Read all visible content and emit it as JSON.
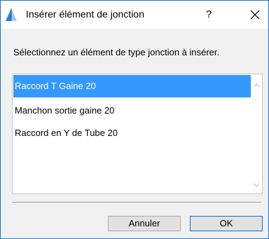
{
  "window": {
    "title": "Insérer élément de jonction",
    "help_label": "?",
    "close_icon": "close-icon",
    "app_icon": "archicad-icon",
    "accent_color": "#1874d4"
  },
  "prompt": "Sélectionnez un élément de type jonction à insérer.",
  "list": {
    "items": [
      {
        "label": "Raccord T Gaine 20",
        "selected": true
      },
      {
        "label": "Manchon sortie gaine 20",
        "selected": false
      },
      {
        "label": "Raccord en Y de Tube 20",
        "selected": false
      }
    ],
    "selection_color": "#3399ff"
  },
  "buttons": {
    "cancel_label": "Annuler",
    "ok_label": "OK"
  }
}
